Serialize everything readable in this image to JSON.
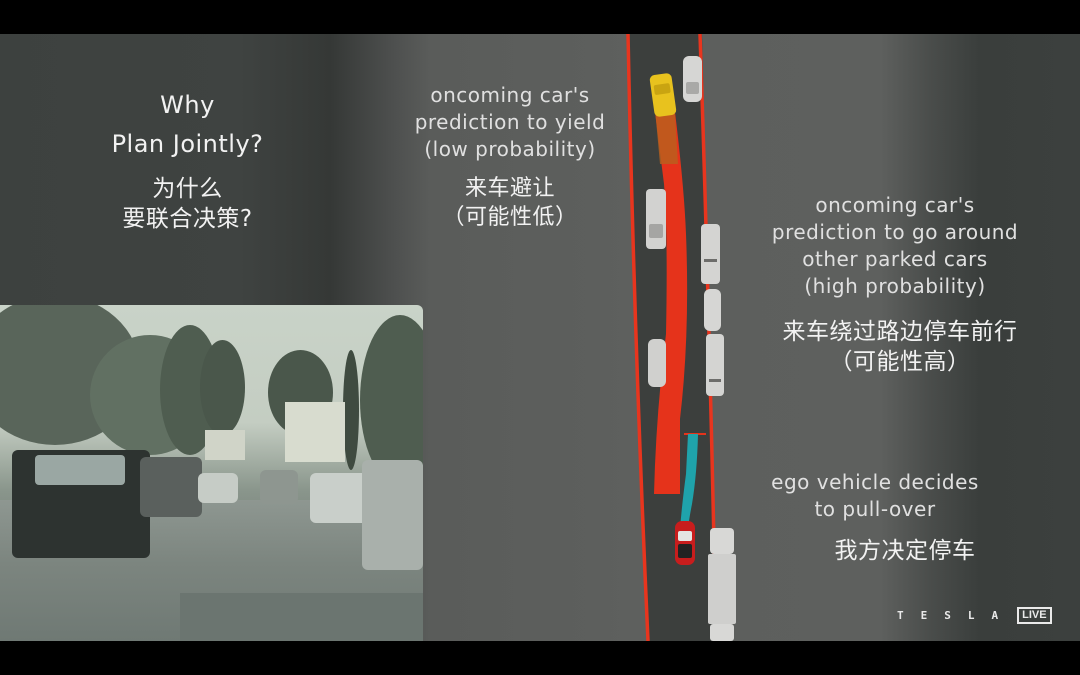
{
  "slide": {
    "title_lines": [
      "Why",
      "Plan Jointly?"
    ],
    "title_cn_lines": [
      "为什么",
      "要联合决策?"
    ],
    "annotations": {
      "yield": {
        "en_lines": [
          "oncoming car's",
          "prediction to yield",
          "(low probability)"
        ],
        "cn_lines": [
          "来车避让",
          "（可能性低）"
        ]
      },
      "go_around": {
        "en_lines": [
          "oncoming car's",
          "prediction to go around",
          "other parked cars",
          "(high probability)"
        ],
        "cn_lines": [
          "来车绕过路边停车前行",
          "（可能性高）"
        ]
      },
      "ego": {
        "en_lines": [
          "ego vehicle decides",
          "to pull-over"
        ],
        "cn_lines": [
          "我方决定停车"
        ]
      }
    },
    "brand": {
      "wordmark": "TESLA",
      "badge": "LIVE"
    },
    "colors": {
      "background": "#3d413f",
      "road": "#3c3f3d",
      "lane_boundary": "#e8351e",
      "prediction_path": "#e5331b",
      "ego_path": "#1fa3ab",
      "oncoming_car": "#e8c21e",
      "ego_car": "#c81d1d",
      "parked_car": "#d4d4d2"
    },
    "visualization": {
      "icons": {
        "oncoming_car": "yellow-car-icon",
        "ego_car": "red-car-icon",
        "parked_car": "white-car-icon"
      }
    }
  }
}
